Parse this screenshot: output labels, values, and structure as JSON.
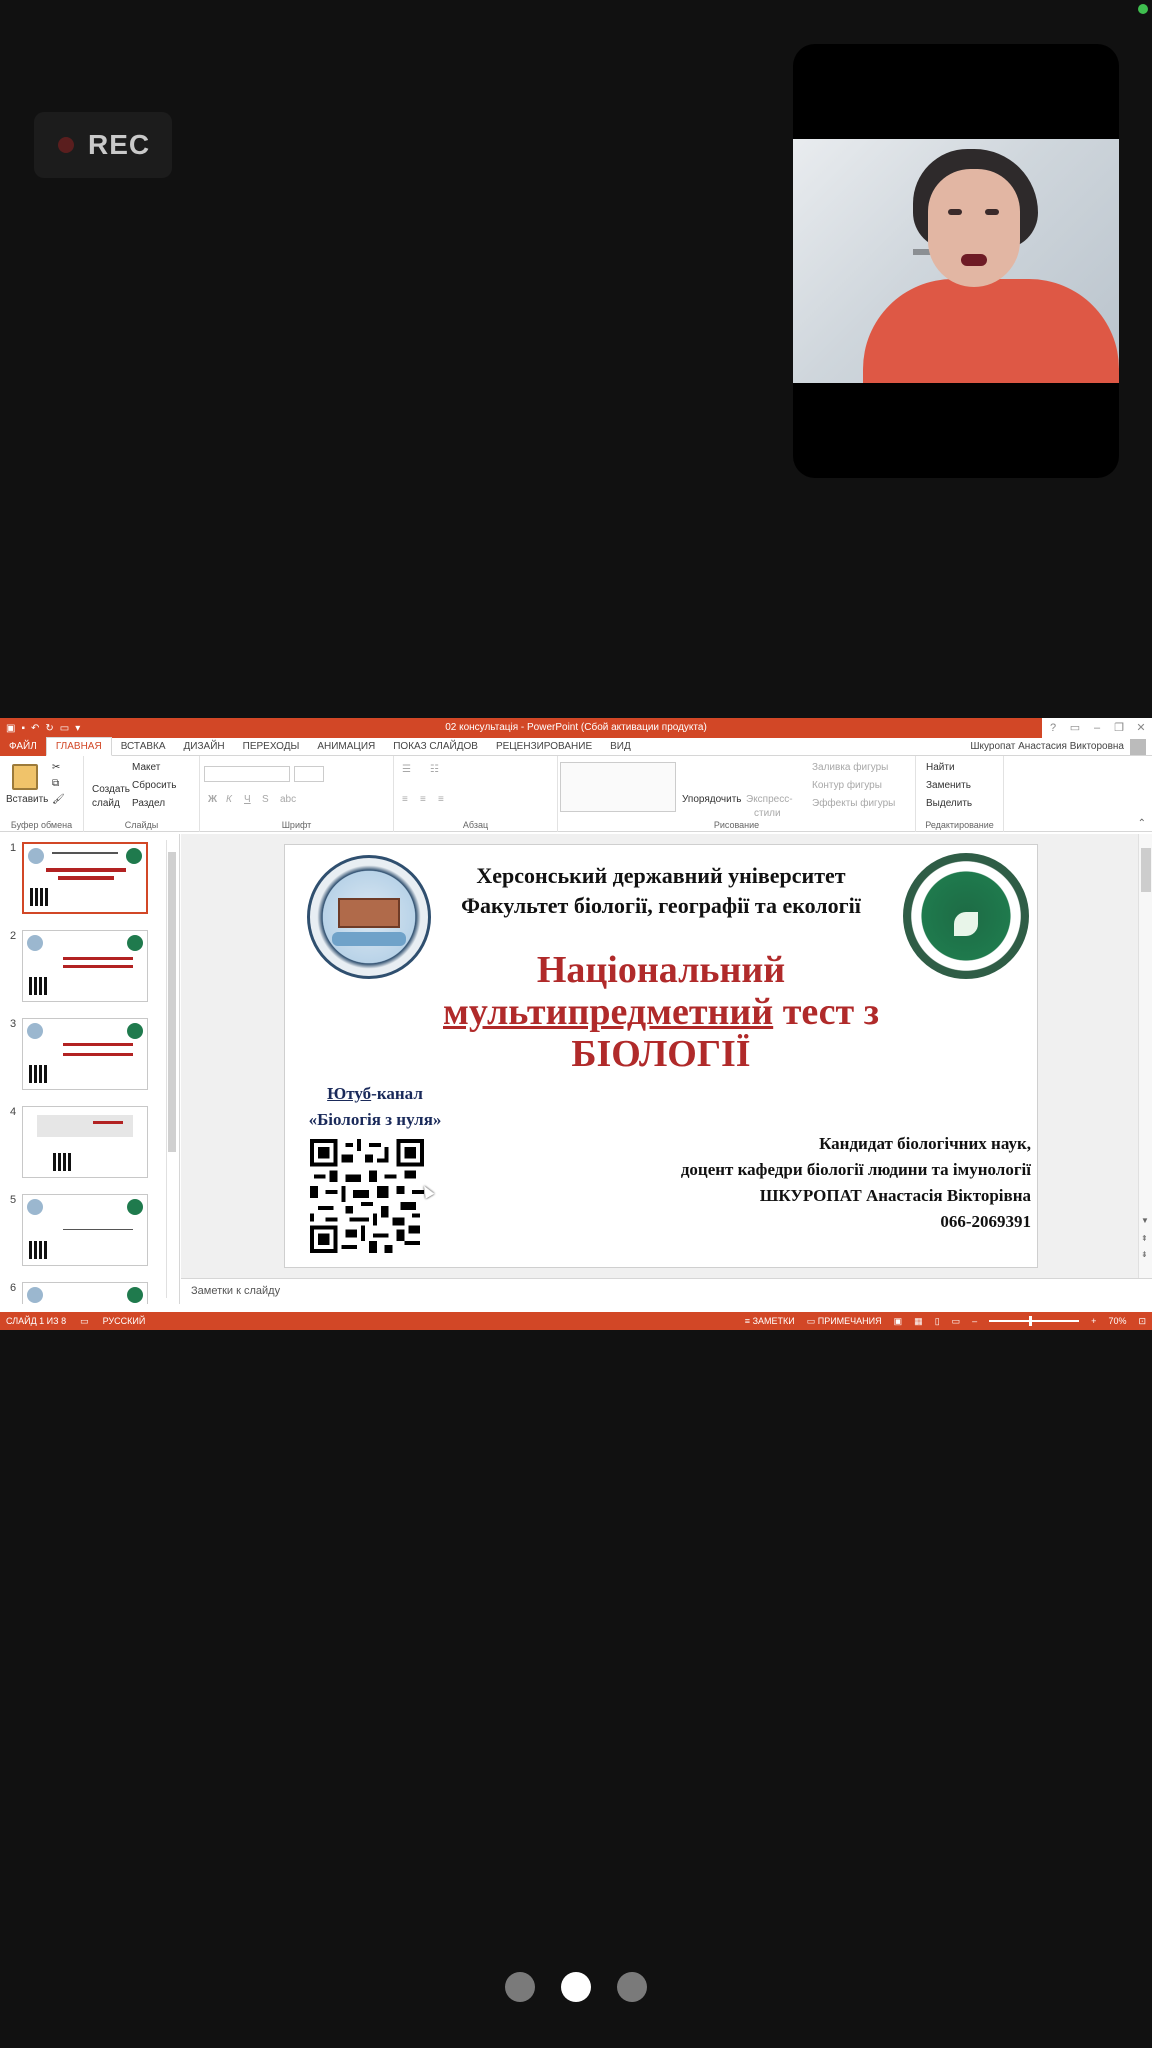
{
  "rec": {
    "label": "REC"
  },
  "powerpoint": {
    "window_title": "02 консультація -  PowerPoint (Сбой активации продукта)",
    "tabs": [
      "ФАЙЛ",
      "ГЛАВНАЯ",
      "ВСТАВКА",
      "ДИЗАЙН",
      "ПЕРЕХОДЫ",
      "АНИМАЦИЯ",
      "ПОКАЗ СЛАЙДОВ",
      "РЕЦЕНЗИРОВАНИЕ",
      "ВИД"
    ],
    "user": "Шкуропат Анастасия Викторовна",
    "ribbon": {
      "paste": "Вставить",
      "create_slide_1": "Создать",
      "create_slide_2": "слайд",
      "layout": "Макет",
      "reset": "Сбросить",
      "section": "Раздел",
      "arrange": "Упорядочить",
      "express_1": "Экспресс-",
      "express_2": "стили",
      "shape_fill": "Заливка фигуры",
      "shape_outline": "Контур фигуры",
      "shape_effects": "Эффекты фигуры",
      "find": "Найти",
      "replace": "Заменить",
      "select": "Выделить",
      "groups": {
        "clipboard": "Буфер обмена",
        "slides": "Слайды",
        "font": "Шрифт",
        "paragraph": "Абзац",
        "drawing": "Рисование",
        "editing": "Редактирование"
      }
    },
    "thumbnails": [
      "1",
      "2",
      "3",
      "4",
      "5",
      "6"
    ],
    "slide": {
      "university": "Херсонський державний університет",
      "faculty": "Факультет біології, географії та екології",
      "title_line1": "Національний",
      "title_line2_ul": "мультипредметний",
      "title_line2_rest": " тест з",
      "title_line3": "БІОЛОГІЇ",
      "yt_ul": "Ютуб",
      "yt_rest": "-канал",
      "yt_channel": "«Біологія з нуля»",
      "author_line1": "Кандидат біологічних наук,",
      "author_line2": "доцент кафедри біології людини та імунології",
      "author_line3": "ШКУРОПАТ Анастасія Вікторівна",
      "author_phone": "066-2069391"
    },
    "notes_placeholder": "Заметки к слайду",
    "status": {
      "slide_counter": "СЛАЙД 1 ИЗ 8",
      "language": "РУССКИЙ",
      "notes": "ЗАМЕТКИ",
      "comments": "ПРИМЕЧАНИЯ",
      "zoom": "70%"
    }
  },
  "pager": {
    "pages": 3,
    "active_index": 1
  }
}
